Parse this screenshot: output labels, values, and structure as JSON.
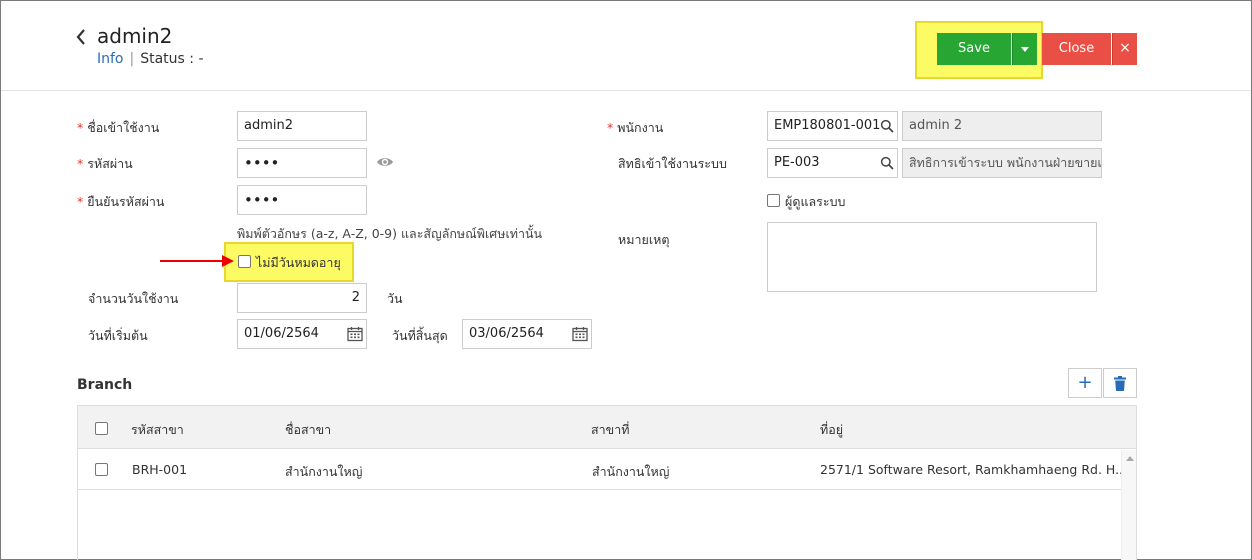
{
  "header": {
    "title": "admin2",
    "info_link": "Info",
    "separator": "|",
    "status_label": "Status",
    "status_colon": ":",
    "status_value": "-"
  },
  "toolbar": {
    "save_label": "Save",
    "close_label": "Close",
    "close_x": "×"
  },
  "form": {
    "username": {
      "label": "ชื่อเข้าใช้งาน",
      "value": "admin2",
      "required": "*"
    },
    "password": {
      "label": "รหัสผ่าน",
      "value": "••••",
      "required": "*"
    },
    "confirm_password": {
      "label": "ยืนยันรหัสผ่าน",
      "value": "••••",
      "required": "*"
    },
    "password_hint": "พิมพ์ตัวอักษร (a-z, A-Z, 0-9) และสัญลักษณ์พิเศษเท่านั้น",
    "no_expiry": {
      "label": "ไม่มีวันหมดอายุ",
      "checked": false
    },
    "days": {
      "label": "จำนวนวันใช้งาน",
      "value": "2",
      "unit": "วัน"
    },
    "start_date": {
      "label": "วันที่เริ่มต้น",
      "value": "01/06/2564"
    },
    "end_date": {
      "label": "วันที่สิ้นสุด",
      "value": "03/06/2564"
    },
    "employee": {
      "label": "พนักงาน",
      "code": "EMP180801-001",
      "name": "admin 2",
      "required": "*"
    },
    "access_right": {
      "label": "สิทธิเข้าใช้งานระบบ",
      "code": "PE-003",
      "name": "สิทธิการเข้าระบบ พนักงานฝ่ายขายเ"
    },
    "admin": {
      "label": "ผู้ดูแลระบบ",
      "checked": false
    },
    "note": {
      "label": "หมายเหตุ",
      "value": ""
    }
  },
  "branch": {
    "title": "Branch",
    "add_icon_glyph": "+",
    "columns": [
      "รหัสสาขา",
      "ชื่อสาขา",
      "สาขาที่",
      "ที่อยู่"
    ],
    "rows": [
      {
        "code": "BRH-001",
        "name": "สำนักงานใหญ่",
        "branch_no": "สำนักงานใหญ่",
        "address": "2571/1 Software Resort, Ramkhamhaeng Rd. H..."
      }
    ]
  },
  "colors": {
    "save": "#27a634",
    "close": "#e94f45",
    "highlight": "#fdfb63",
    "link": "#2a6bb5",
    "required": "#e0342a",
    "arrow": "#ee0000"
  }
}
